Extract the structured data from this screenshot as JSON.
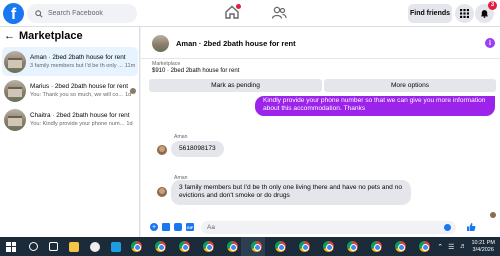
{
  "search": {
    "placeholder": "Search Facebook"
  },
  "header": {
    "find_friends": "Find friends",
    "messenger_badge": "3"
  },
  "marketplace": {
    "title": "Marketplace",
    "conversations": [
      {
        "name": "Aman · 2bed 2bath house for rent",
        "preview": "3 family members but I'd be th only ...",
        "time": "11m"
      },
      {
        "name": "Marius · 2bed 2bath house for rent",
        "preview": "You: Thank you so much, we will co...",
        "time": "1d"
      },
      {
        "name": "Chaitra · 2bed 2bath house for rent",
        "preview": "You: Kindly provide your phone num...",
        "time": "1d"
      }
    ]
  },
  "chat": {
    "title": "Aman · 2bed 2bath house for rent",
    "listing_label": "Marketplace",
    "listing_value": "$910 · 2bed 2bath house for rent",
    "mark_pending": "Mark as pending",
    "more_options": "More options",
    "messages": [
      {
        "sender": "",
        "text": "Kindly provide your phone number so that we can give you more information about this accommodation. Thanks",
        "outgoing": true
      },
      {
        "sender": "Aman",
        "text": "5618098173",
        "outgoing": false
      },
      {
        "sender": "Aman",
        "text": "3 family members but I'd be th only one living there and have no pets and no evictions and don't smoke or do drugs",
        "outgoing": false
      }
    ],
    "composer_placeholder": "Aa"
  },
  "taskbar": {
    "time": "10:21 PM",
    "date": "3/4/2026"
  },
  "colors": {
    "accent": "#1877f2",
    "outgoing_bubble": "#9b23ea",
    "incoming_bubble": "#e4e6eb",
    "notification": "#e41e3f"
  }
}
